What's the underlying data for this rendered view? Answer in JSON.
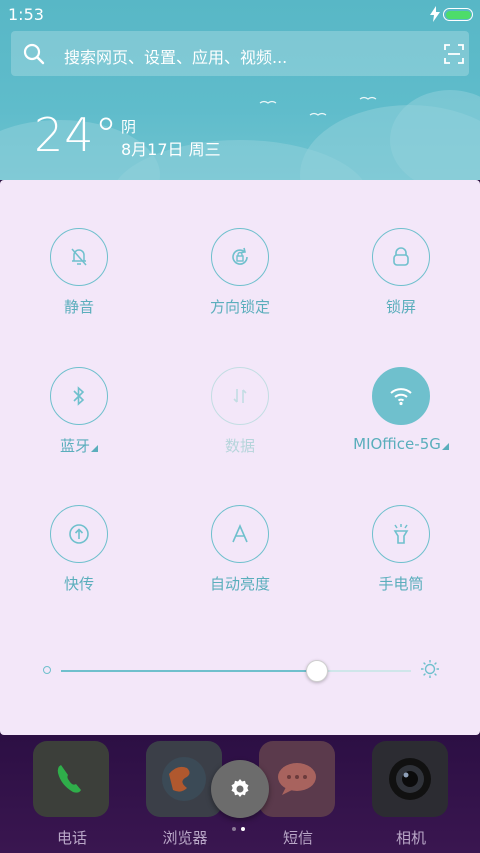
{
  "status_bar": {
    "time": "1:53",
    "battery_level": 1.0
  },
  "search": {
    "placeholder": "搜索网页、设置、应用、视频..."
  },
  "weather": {
    "temperature": "24°",
    "condition": "阴",
    "date": "8月17日 周三"
  },
  "toggles": [
    {
      "label": "静音",
      "icon": "mute-bell-icon",
      "state": "off"
    },
    {
      "label": "方向锁定",
      "icon": "rotation-lock-icon",
      "state": "off"
    },
    {
      "label": "锁屏",
      "icon": "lock-icon",
      "state": "off"
    },
    {
      "label": "蓝牙",
      "icon": "bluetooth-icon",
      "state": "off",
      "expandable": true
    },
    {
      "label": "数据",
      "icon": "mobile-data-icon",
      "state": "disabled"
    },
    {
      "label": "MIOffice-5G",
      "icon": "wifi-icon",
      "state": "on",
      "expandable": true
    },
    {
      "label": "快传",
      "icon": "quick-transfer-icon",
      "state": "off"
    },
    {
      "label": "自动亮度",
      "icon": "auto-brightness-icon",
      "state": "off"
    },
    {
      "label": "手电筒",
      "icon": "flashlight-icon",
      "state": "off"
    }
  ],
  "brightness": {
    "level": 0.73
  },
  "dock": {
    "apps": [
      {
        "label": "电话",
        "icon": "phone-icon"
      },
      {
        "label": "浏览器",
        "icon": "browser-icon"
      },
      {
        "label": "短信",
        "icon": "messages-icon"
      },
      {
        "label": "相机",
        "icon": "camera-icon"
      }
    ],
    "page_count": 2,
    "current_page": 2
  },
  "colors": {
    "accent": "#6fc0cd",
    "panel_bg": "#f3e7f9",
    "header_bg": "#5fbccb"
  }
}
